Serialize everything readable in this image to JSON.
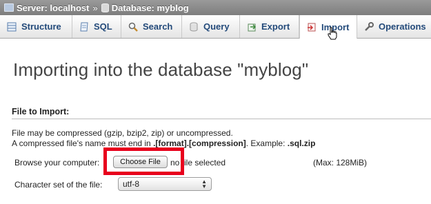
{
  "breadcrumb": {
    "server": "Server: localhost",
    "separator": "»",
    "database": "Database: myblog"
  },
  "tabs": [
    {
      "label": "Structure",
      "icon": "structure-icon"
    },
    {
      "label": "SQL",
      "icon": "sql-icon"
    },
    {
      "label": "Search",
      "icon": "search-icon"
    },
    {
      "label": "Query",
      "icon": "query-icon"
    },
    {
      "label": "Export",
      "icon": "export-icon"
    },
    {
      "label": "Import",
      "icon": "import-icon",
      "active": true
    },
    {
      "label": "Operations",
      "icon": "operations-icon"
    }
  ],
  "page": {
    "title": "Importing into the database \"myblog\"",
    "section_title": "File to Import:",
    "note1": "File may be compressed (gzip, bzip2, zip) or uncompressed.",
    "note2_prefix": "A compressed file's name must end in ",
    "note2_format": ".[format].[compression]",
    "note2_mid": ". Example: ",
    "note2_example": ".sql.zip",
    "browse_label": "Browse your computer:",
    "choose_button": "Choose File",
    "no_file": "no file selected",
    "max_size": "(Max: 128MiB)",
    "charset_label": "Character set of the file:",
    "charset_value": "utf-8"
  },
  "colors": {
    "highlight": "#e8001c",
    "tab_text": "#234a7a",
    "topbar": "#8a8a8a"
  }
}
